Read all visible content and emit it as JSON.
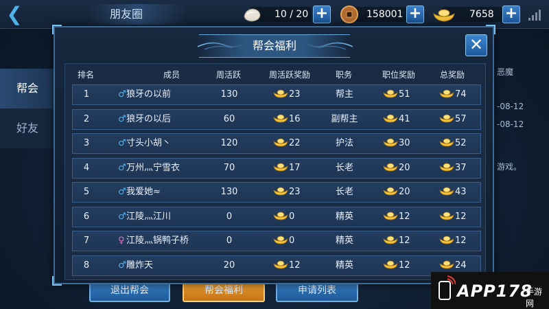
{
  "topbar": {
    "back_icon": "back-arrow-icon",
    "title": "朋友圈",
    "resources": [
      {
        "icon": "stone-icon",
        "value": "10 / 20"
      },
      {
        "icon": "coin-icon",
        "value": "158001"
      },
      {
        "icon": "gold-ingot-icon",
        "value": "7658"
      }
    ],
    "plus_label": "+"
  },
  "side_tabs": [
    {
      "label": "帮会",
      "active": true
    },
    {
      "label": "好友",
      "active": false
    }
  ],
  "background": {
    "fragments": [
      "恶魔",
      "-08-12",
      "-08-12",
      "游戏。"
    ]
  },
  "bottom_buttons": [
    {
      "label": "退出帮会",
      "style": "blue"
    },
    {
      "label": "帮会福利",
      "style": "orange"
    },
    {
      "label": "申请列表",
      "style": "blue"
    }
  ],
  "dialog": {
    "title": "帮会福利",
    "close_label": "✕",
    "columns": [
      "排名",
      "成员",
      "周活跃",
      "周活跃奖励",
      "职务",
      "职位奖励",
      "总奖励"
    ],
    "rows": [
      {
        "rank": "1",
        "gender": "male",
        "name": "狼牙の以前",
        "weekly_active": "130",
        "active_reward": "23",
        "role": "帮主",
        "role_reward": "51",
        "total": "74"
      },
      {
        "rank": "2",
        "gender": "male",
        "name": "狼牙の以后",
        "weekly_active": "60",
        "active_reward": "16",
        "role": "副帮主",
        "role_reward": "41",
        "total": "57"
      },
      {
        "rank": "3",
        "gender": "male",
        "name": "寸头小胡丶",
        "weekly_active": "120",
        "active_reward": "22",
        "role": "护法",
        "role_reward": "30",
        "total": "52"
      },
      {
        "rank": "4",
        "gender": "male",
        "name": "万州灬宁雪衣",
        "weekly_active": "70",
        "active_reward": "17",
        "role": "长老",
        "role_reward": "20",
        "total": "37"
      },
      {
        "rank": "5",
        "gender": "male",
        "name": "我爱她≈",
        "weekly_active": "130",
        "active_reward": "23",
        "role": "长老",
        "role_reward": "20",
        "total": "43"
      },
      {
        "rank": "6",
        "gender": "male",
        "name": "江陵灬江川",
        "weekly_active": "0",
        "active_reward": "0",
        "role": "精英",
        "role_reward": "12",
        "total": "12"
      },
      {
        "rank": "7",
        "gender": "female",
        "name": "江陵灬锅鸭子桥",
        "weekly_active": "0",
        "active_reward": "0",
        "role": "精英",
        "role_reward": "12",
        "total": "12"
      },
      {
        "rank": "8",
        "gender": "male",
        "name": "雕炸天",
        "weekly_active": "20",
        "active_reward": "12",
        "role": "精英",
        "role_reward": "12",
        "total": "24"
      }
    ]
  },
  "colors": {
    "male": "#56b4ee",
    "female": "#e86ec9",
    "gold": "#f3c13a",
    "accent_blue": "#3a86cf",
    "accent_orange": "#e99a2c"
  },
  "watermark": {
    "text": "APP178",
    "sub": "手游网"
  }
}
